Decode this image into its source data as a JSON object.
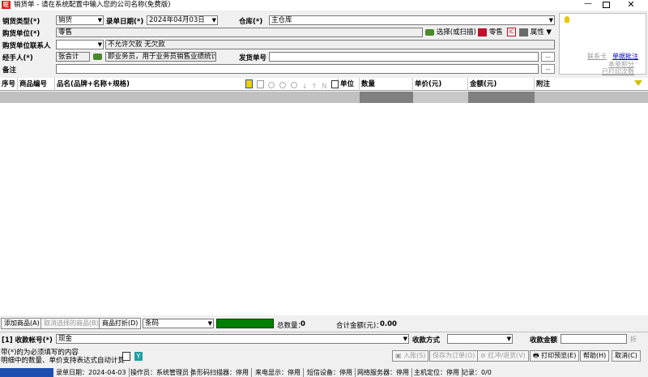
{
  "window": {
    "title": "销货单 - 请在系统配置中输入您的公司名称(免费版)",
    "app_icon": "旺"
  },
  "header": {
    "sale_type_label": "销货类型(*)",
    "sale_type_value": "销货",
    "entry_date_label": "录单日期(*)",
    "entry_date_value": "2024年04月03日",
    "warehouse_label": "仓库(*)",
    "warehouse_value": "主仓库",
    "buyer_label": "购货单位(*)",
    "buyer_value": "零售",
    "select_scan_label": "选择(或扫描)",
    "retail_label": "零售",
    "props_label": "属性",
    "contact_label": "购货单位联系人",
    "credit_value": "不允许欠款  无欠款",
    "handler_label": "经手人(*)",
    "handler_value": "张会计",
    "handler_desc": "即业务员，用于业务员销售业绩统计",
    "ship_no_label": "发货单号",
    "ship_no_value": "",
    "remark_label": "备注",
    "remark_value": "",
    "more_label": "..."
  },
  "side_panel": {
    "contact_card": "联系卡",
    "single_note": "单据批注",
    "single_points": "本单积分",
    "printed": "已打印次数"
  },
  "table": {
    "columns": [
      "序号",
      "商品编号",
      "品名(品牌+名称+规格)",
      "单位",
      "数量",
      "单价(元)",
      "金额(元)",
      "附注"
    ],
    "tool_icons": [
      "search-person-icon",
      "table-icon",
      "chat-icon",
      "chat-icon",
      "chat-icon",
      "arrow-down-icon",
      "arrow-up-icon",
      "n-icon",
      "print-preview-icon"
    ]
  },
  "bottom_toolbar": {
    "add_goods": "添加商品(A)",
    "cancel_selected": "取消选择的商品(B)",
    "goods_discount": "商品打折(D)",
    "barcode_value": "条码",
    "total_qty_label": "总数量：",
    "total_qty_value": "0",
    "total_amount_label": "合计金额(元)：",
    "total_amount_value": "0.00"
  },
  "payment": {
    "account_label": "[1] 收款帐号(*)",
    "account_value": "现金",
    "method_label": "收款方式",
    "method_value": "",
    "amount_label": "收款金额",
    "amount_value": ""
  },
  "footer": {
    "note1": "带(*)的为必须填写的内容",
    "note2": "明细中的数量、单价支持表达式自动计算",
    "btn_stock_in": "入账(S)",
    "btn_save_order": "保存为订单(O)",
    "btn_red_return": "红冲/退货(V)",
    "btn_print_preview": "打印预览(E)",
    "btn_help": "帮助(H)",
    "btn_cancel": "取消(C)"
  },
  "status_bar": {
    "entry_date": "录单日期：2024-04-03",
    "operator": "操作员：系统管理员",
    "scanner": "条形码扫描器：停用",
    "caller_id": "来电显示：停用",
    "sms": "短信设备：停用",
    "network": "网络服务器：停用",
    "host_pos": "主机定位：停用",
    "records": "记录：0/0"
  },
  "colors": {
    "green_bar": "#008000",
    "link_blue": "#0000cc",
    "grid_dark": "#808080",
    "taskbar_blue": "#1e4fb0"
  }
}
